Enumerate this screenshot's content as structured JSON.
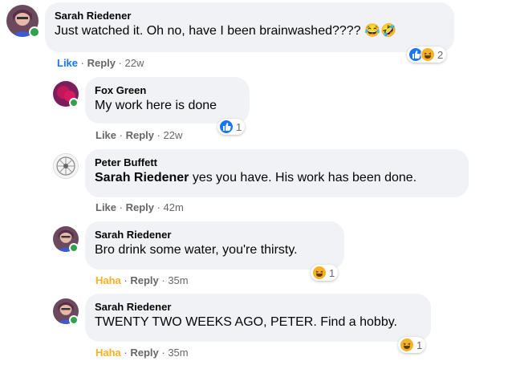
{
  "comments": [
    {
      "author": "Sarah Riedener",
      "text": "Just watched it. Oh no, have I been brainwashed????",
      "emoji": "😂🤣",
      "action_reaction": "Like",
      "reply": "Reply",
      "time": "22w",
      "reaction_icons": [
        "like-icon",
        "haha-icon"
      ],
      "reaction_count": "2"
    },
    {
      "author": "Fox Green",
      "text": "My work here is done",
      "action_reaction": "Like",
      "reply": "Reply",
      "time": "22w",
      "reaction_icons": [
        "like-icon"
      ],
      "reaction_count": "1"
    },
    {
      "author": "Peter Buffett",
      "mention": "Sarah Riedener",
      "text": " yes you have. His work has been done.",
      "action_reaction": "Like",
      "reply": "Reply",
      "time": "42m"
    },
    {
      "author": "Sarah Riedener",
      "text": "Bro drink some water, you're thirsty.",
      "action_reaction": "Haha",
      "reply": "Reply",
      "time": "35m",
      "reaction_icons": [
        "haha-icon"
      ],
      "reaction_count": "1"
    },
    {
      "author": "Sarah Riedener",
      "text": "TWENTY TWO WEEKS AGO, PETER. Find a hobby.",
      "action_reaction": "Haha",
      "reply": "Reply",
      "time": "35m",
      "reaction_icons": [
        "haha-icon"
      ],
      "reaction_count": "1"
    }
  ],
  "colors": {
    "bubble": "#f0f2f5",
    "like_blue": "#1877f2",
    "haha_yellow": "#f7b125",
    "online_green": "#31a24c",
    "meta_gray": "#65676b"
  }
}
